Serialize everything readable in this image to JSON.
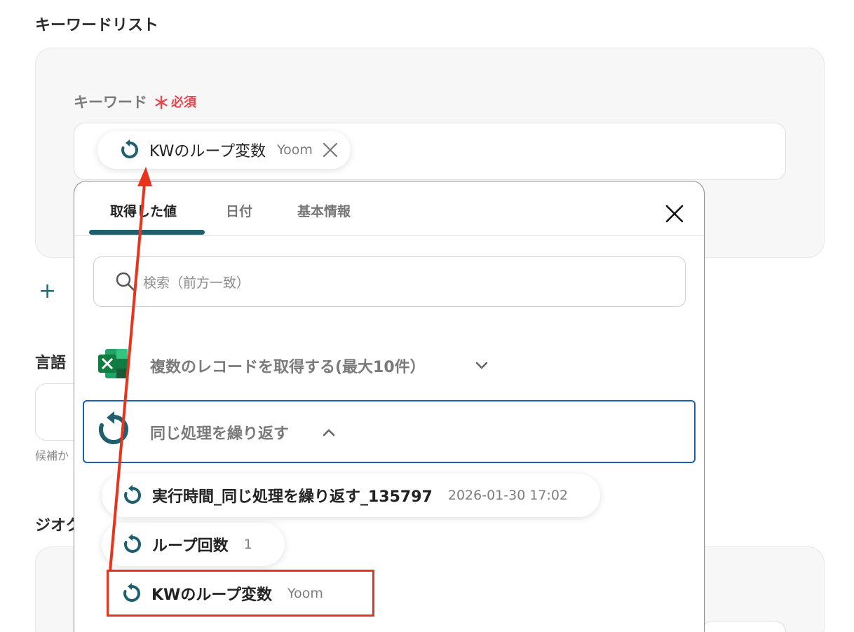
{
  "keyword_list": {
    "title": "キーワードリスト",
    "field_label": "キーワード",
    "required_star": "＊",
    "required_text": "必須",
    "selected_chip": {
      "label": "KWのループ変数",
      "value": "Yoom"
    }
  },
  "add_button_label": "+",
  "language_section": {
    "title": "言語",
    "hint_partial": "候補か"
  },
  "geo_section": {
    "title_partial": "ジオク"
  },
  "picker": {
    "tabs": [
      "取得した値",
      "日付",
      "基本情報"
    ],
    "search_placeholder": "検索（前方一致）",
    "groups": [
      {
        "label": "複数のレコードを取得する(最大10件）",
        "icon": "excel-icon",
        "state": "collapsed"
      },
      {
        "label": "同じ処理を繰り返す",
        "icon": "loop-icon",
        "state": "expanded"
      }
    ],
    "items": [
      {
        "label": "実行時間_同じ処理を繰り返す_135797",
        "value": "2026-01-30 17:02"
      },
      {
        "label": "ループ回数",
        "value": "1"
      },
      {
        "label": "KWのループ変数",
        "value": "Yoom"
      }
    ]
  },
  "colors": {
    "accent": "#1f5f6e",
    "required": "#e5484d",
    "highlight_box": "#e8341c",
    "selected_group_border": "#1a5fb4",
    "excel_green": "#1d7044"
  }
}
